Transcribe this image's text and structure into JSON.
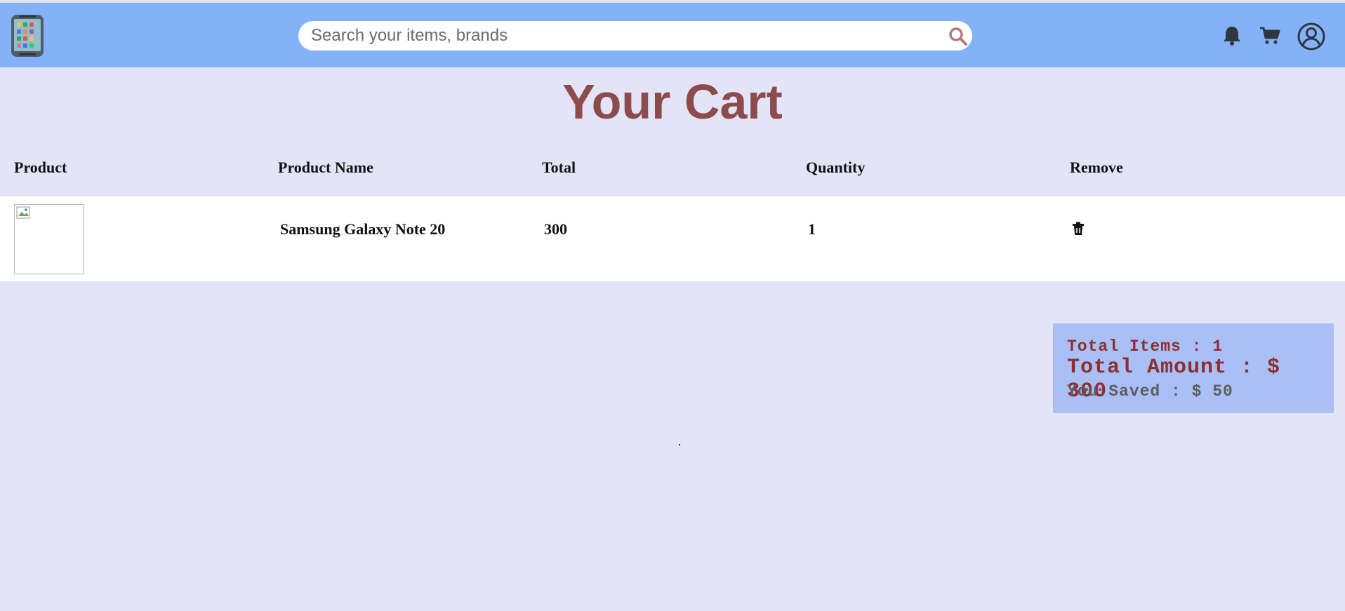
{
  "header": {
    "logo_icon": "tablet-logo-icon",
    "search": {
      "placeholder": "Search your items, brands",
      "icon": "search-icon"
    },
    "icons": [
      "bell-icon",
      "cart-icon",
      "user-account-icon"
    ]
  },
  "page": {
    "title_regular": "Your ",
    "title_bold": "Cart"
  },
  "table": {
    "headers": [
      "Product",
      "Product Name",
      "Total",
      "Quantity",
      "Remove"
    ],
    "rows": [
      {
        "product_name": "Samsung Galaxy Note 20",
        "total": "300",
        "quantity": "1",
        "remove_icon": "trash-icon"
      }
    ]
  },
  "summary": {
    "total_items": "Total Items : 1",
    "total_amount": "Total Amount : $ 300",
    "you_saved": "You Saved : $ 50"
  },
  "colors": {
    "header_bg": "#83b2f8",
    "page_bg": "#e3e4f8",
    "title": "#8d4b4b",
    "summary_bg": "#a9bff5",
    "summary_text": "#8d2e2e"
  }
}
